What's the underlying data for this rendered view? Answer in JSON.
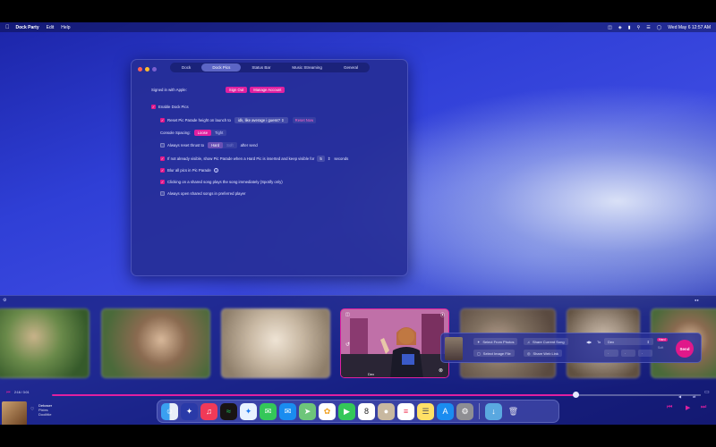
{
  "menubar": {
    "app_name": "Dock Party",
    "menus": [
      "Edit",
      "Help"
    ],
    "datetime": "Wed May 6  12:57 AM"
  },
  "window": {
    "tabs": [
      "Dock",
      "Dock Pics",
      "Status Bar",
      "Music Streaming",
      "General"
    ],
    "active_tab": "Dock Pics",
    "signed_in_label": "Signed in with Apple:",
    "sign_out_label": "Sign Out",
    "manage_account_label": "Manage Account",
    "enable_dock_pics": "Enable Dock Pics",
    "reset_height_label": "Reset Pic Parade height on launch to",
    "height_value": "idk, like average i guess?",
    "reset_now_label": "Reset Now",
    "console_spacing_label": "Console Spacing:",
    "spacing_options": [
      "Loose",
      "Tight"
    ],
    "selected_spacing": "Loose",
    "always_reset_label": "Always reset thrust to",
    "thrust_options": [
      "Hard",
      "Soft"
    ],
    "after_send_label": "after send",
    "if_not_visible_label": "If not already visible, show Pic Parade when a Hard Pic is inserted and keep visible for",
    "visible_seconds": "5",
    "seconds_label": "seconds",
    "blur_label": "Blur all pics in Pic Parade",
    "clicking_label": "Clicking on a shared song plays the song immediately (Spotify only)",
    "always_open_label": "Always open shared songs in preferred player"
  },
  "player": {
    "time": "2:16 / 3:01",
    "song": "Debaser",
    "artist": "Pixies",
    "album": "Doolittle",
    "progress_fraction": 0.74
  },
  "feature_photo_caption": "Dex",
  "popover": {
    "select_from_photos": "Select From Photos",
    "share_current_song": "Share Current Song",
    "select_image_file": "Select Image File",
    "share_web_link": "Share Web Link",
    "to_label": "To",
    "recipient": "Dex",
    "hard_label": "Hard",
    "soft_label": "Soft",
    "send_label": "Send"
  },
  "dock_apps": [
    "finder-icon",
    "dock-party-icon",
    "music-icon",
    "spotify-icon",
    "safari-icon",
    "messages-icon",
    "mail-icon",
    "maps-icon",
    "photos-icon",
    "facetime-icon",
    "calendar-icon",
    "contacts-icon",
    "reminders-icon",
    "notes-icon",
    "app-store-icon",
    "settings-icon",
    "downloads-folder-icon",
    "trash-icon"
  ],
  "calendar_day": "8"
}
